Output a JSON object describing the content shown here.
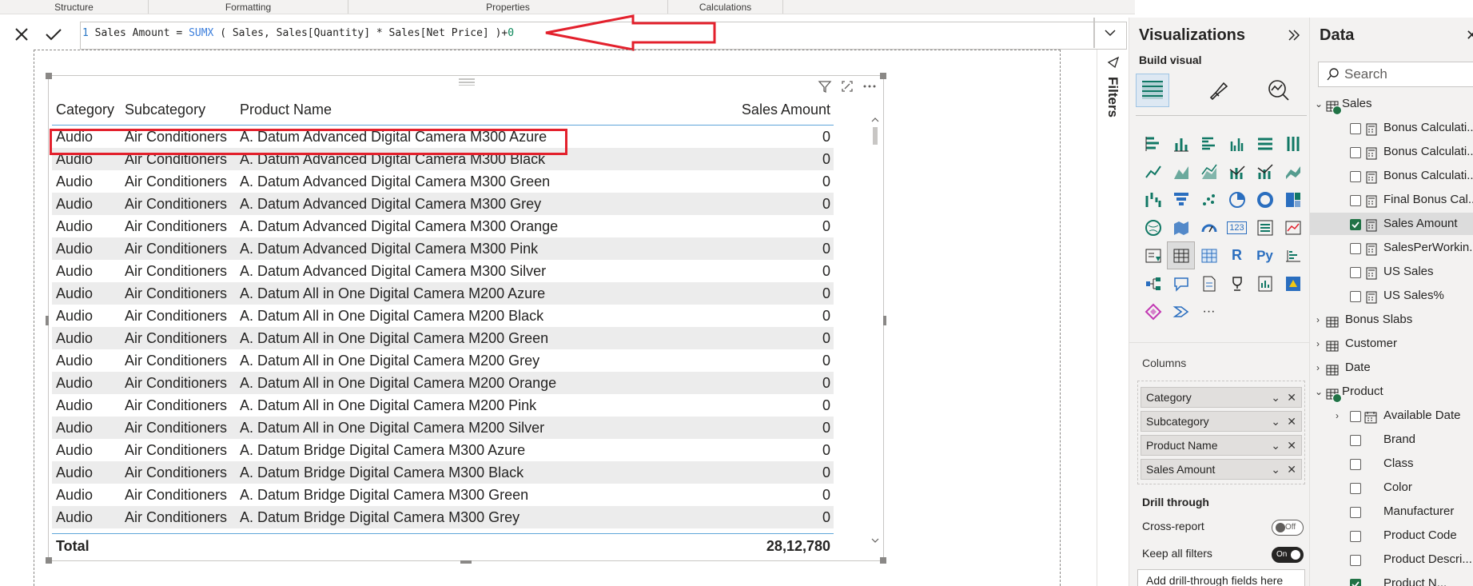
{
  "ribbon": {
    "groups": [
      "Structure",
      "Formatting",
      "Properties",
      "Calculations"
    ]
  },
  "formula": {
    "line_number": "1",
    "name": "Sales Amount",
    "equals": "=",
    "func": "SUMX",
    "args": "( Sales, Sales[Quantity] * Sales[Net Price] )",
    "plus": "+",
    "zero": "0"
  },
  "table": {
    "headers": [
      "Category",
      "Subcategory",
      "Product Name",
      "Sales Amount"
    ],
    "rows": [
      [
        "Audio",
        "Air Conditioners",
        "A. Datum Advanced Digital Camera M300 Azure",
        "0"
      ],
      [
        "Audio",
        "Air Conditioners",
        "A. Datum Advanced Digital Camera M300 Black",
        "0"
      ],
      [
        "Audio",
        "Air Conditioners",
        "A. Datum Advanced Digital Camera M300 Green",
        "0"
      ],
      [
        "Audio",
        "Air Conditioners",
        "A. Datum Advanced Digital Camera M300 Grey",
        "0"
      ],
      [
        "Audio",
        "Air Conditioners",
        "A. Datum Advanced Digital Camera M300 Orange",
        "0"
      ],
      [
        "Audio",
        "Air Conditioners",
        "A. Datum Advanced Digital Camera M300 Pink",
        "0"
      ],
      [
        "Audio",
        "Air Conditioners",
        "A. Datum Advanced Digital Camera M300 Silver",
        "0"
      ],
      [
        "Audio",
        "Air Conditioners",
        "A. Datum All in One Digital Camera M200 Azure",
        "0"
      ],
      [
        "Audio",
        "Air Conditioners",
        "A. Datum All in One Digital Camera M200 Black",
        "0"
      ],
      [
        "Audio",
        "Air Conditioners",
        "A. Datum All in One Digital Camera M200 Green",
        "0"
      ],
      [
        "Audio",
        "Air Conditioners",
        "A. Datum All in One Digital Camera M200 Grey",
        "0"
      ],
      [
        "Audio",
        "Air Conditioners",
        "A. Datum All in One Digital Camera M200 Orange",
        "0"
      ],
      [
        "Audio",
        "Air Conditioners",
        "A. Datum All in One Digital Camera M200 Pink",
        "0"
      ],
      [
        "Audio",
        "Air Conditioners",
        "A. Datum All in One Digital Camera M200 Silver",
        "0"
      ],
      [
        "Audio",
        "Air Conditioners",
        "A. Datum Bridge Digital Camera M300 Azure",
        "0"
      ],
      [
        "Audio",
        "Air Conditioners",
        "A. Datum Bridge Digital Camera M300 Black",
        "0"
      ],
      [
        "Audio",
        "Air Conditioners",
        "A. Datum Bridge Digital Camera M300 Green",
        "0"
      ],
      [
        "Audio",
        "Air Conditioners",
        "A. Datum Bridge Digital Camera M300 Grey",
        "0"
      ]
    ],
    "total_label": "Total",
    "total_value": "28,12,780"
  },
  "filters": {
    "label": "Filters"
  },
  "visualizations": {
    "title": "Visualizations",
    "build_visual": "Build visual",
    "columns_label": "Columns",
    "fields": [
      "Category",
      "Subcategory",
      "Product Name",
      "Sales Amount"
    ],
    "drill_through": "Drill through",
    "cross_report": "Cross-report",
    "cross_report_state": "Off",
    "keep_filters": "Keep all filters",
    "keep_filters_state": "On",
    "add_drill": "Add drill-through fields here",
    "python_label": "Py",
    "r_label": "R",
    "card_label": "123",
    "more_label": "···"
  },
  "data_pane": {
    "title": "Data",
    "search_placeholder": "Search",
    "tables": {
      "sales": "Sales",
      "sales_fields": [
        "Bonus Calculati...",
        "Bonus Calculati...",
        "Bonus Calculati...",
        "Final Bonus Cal...",
        "Sales Amount",
        "SalesPerWorkin...",
        "US Sales",
        "US Sales%"
      ],
      "bonus_slabs": "Bonus Slabs",
      "customer": "Customer",
      "date": "Date",
      "product": "Product",
      "product_fields": [
        "Available Date",
        "Brand",
        "Class",
        "Color",
        "Manufacturer",
        "Product Code",
        "Product Descri...",
        "Product N..."
      ]
    }
  },
  "colors": {
    "accent_red": "#e3202c",
    "check_green": "#217346",
    "header_rule": "#5ea5d9"
  }
}
